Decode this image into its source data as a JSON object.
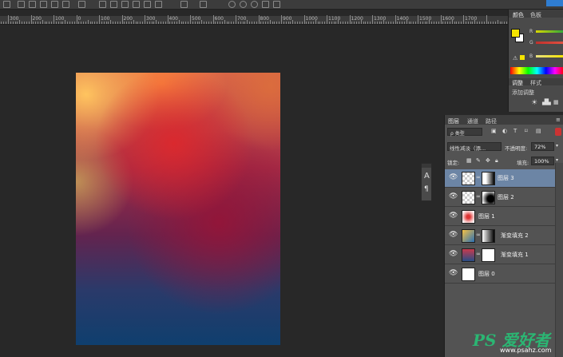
{
  "ruler": {
    "labels": [
      "300",
      "200",
      "100",
      "0",
      "100",
      "200",
      "300",
      "400",
      "500",
      "600",
      "700",
      "800",
      "900",
      "1000",
      "1100",
      "1200",
      "1300",
      "1400",
      "1500",
      "1600",
      "1700"
    ]
  },
  "color_panel": {
    "tabs": [
      "颜色",
      "色板"
    ],
    "channels": [
      "R",
      "G",
      "B"
    ]
  },
  "adjust_panel": {
    "tabs": [
      "调整",
      "样式"
    ],
    "label": "添加调整"
  },
  "layers_panel": {
    "tabs": [
      "图层",
      "通道",
      "路径"
    ],
    "filter_label": "ρ 类型",
    "blend_mode": "线性减淡（添...",
    "opacity_label": "不透明度:",
    "opacity_value": "72%",
    "lock_label": "锁定:",
    "fill_label": "填充:",
    "fill_value": "100%",
    "layers": [
      {
        "name": "图层 3",
        "selected": true
      },
      {
        "name": "图层 2",
        "selected": false
      },
      {
        "name": "图层 1",
        "selected": false
      },
      {
        "name": "渐变填充 2",
        "selected": false
      },
      {
        "name": "渐变填充 1",
        "selected": false
      },
      {
        "name": "图层 0",
        "selected": false
      }
    ]
  },
  "float_tool": {
    "char_icon": "A",
    "para_icon": "¶"
  },
  "watermark": {
    "brand": "PS 爱好者",
    "url": "www.psahz.com"
  },
  "colors": {
    "selection": "#6c85a5",
    "accent": "#2f7dd1",
    "foreground": "#f5e400"
  }
}
